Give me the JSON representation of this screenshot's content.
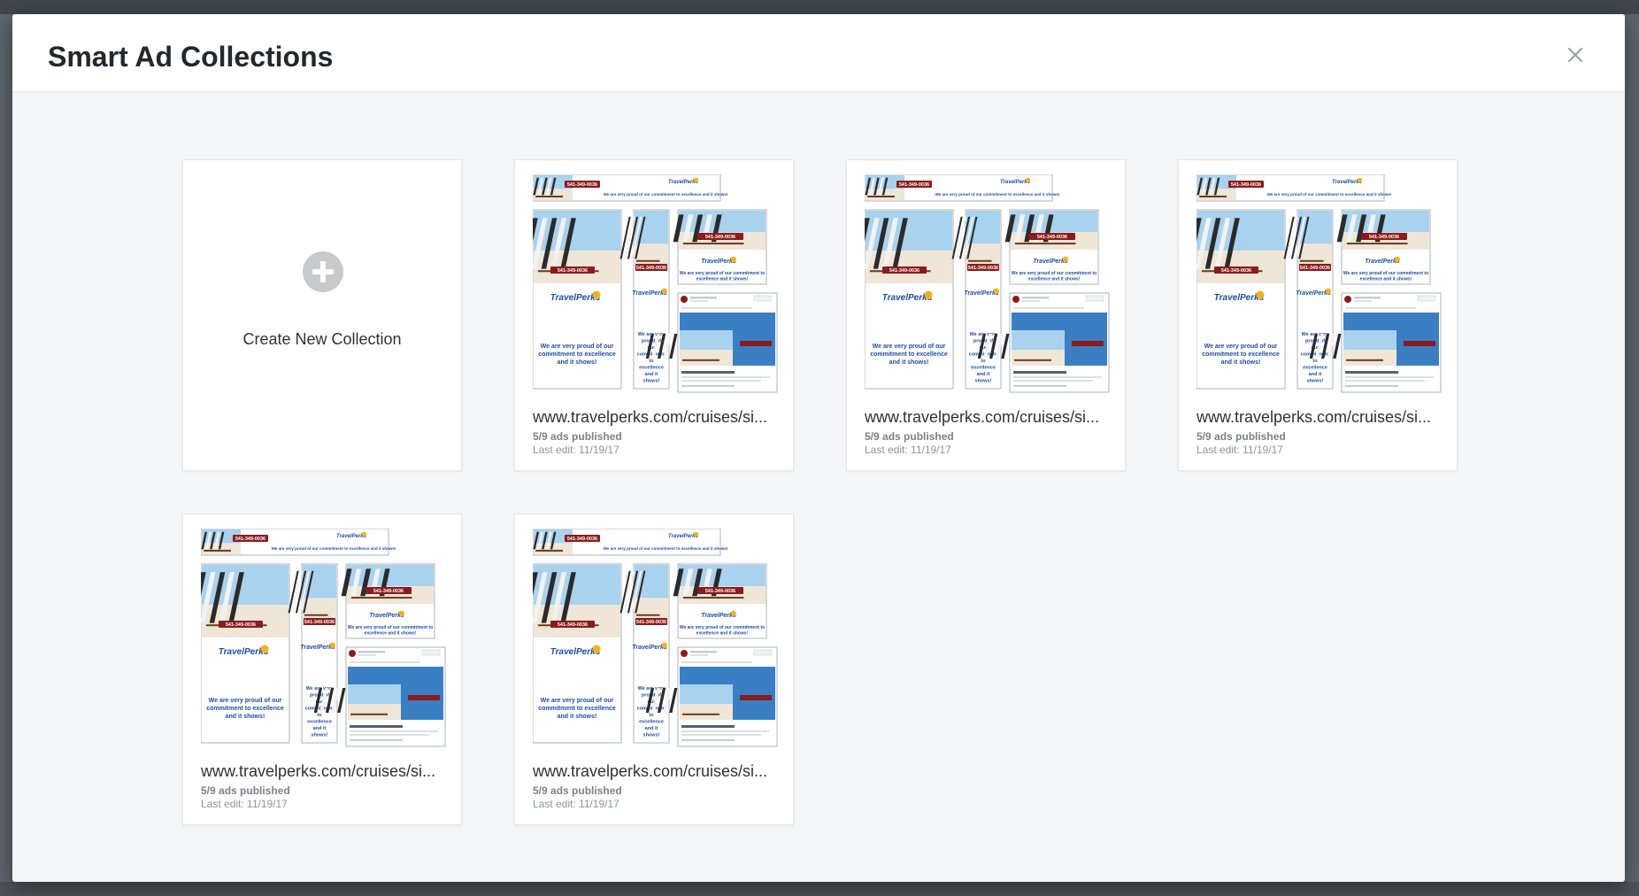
{
  "modal": {
    "title": "Smart Ad Collections",
    "close_label": "×"
  },
  "create_card": {
    "label": "Create New Collection"
  },
  "collections": [
    {
      "url": "www.travelperks.com/cruises/si...",
      "published": "5/9 ads published",
      "last_edit": "Last edit: 11/19/17"
    },
    {
      "url": "www.travelperks.com/cruises/si...",
      "published": "5/9 ads published",
      "last_edit": "Last edit: 11/19/17"
    },
    {
      "url": "www.travelperks.com/cruises/si...",
      "published": "5/9 ads published",
      "last_edit": "Last edit: 11/19/17"
    },
    {
      "url": "www.travelperks.com/cruises/si...",
      "published": "5/9 ads published",
      "last_edit": "Last edit: 11/19/17"
    },
    {
      "url": "www.travelperks.com/cruises/si...",
      "published": "5/9 ads published",
      "last_edit": "Last edit: 11/19/17"
    }
  ],
  "ad_preview": {
    "phone": "541-349-0036",
    "brand": "TravelPerks",
    "tagline": "We are very proud of our commitment to excellence and it shows!",
    "short_tagline": "We are very proud of our commitment to excellence and it shows!"
  },
  "colors": {
    "brand_red": "#8b1c1c",
    "brand_blue": "#1f4ea3",
    "sky": "#a9d2ee",
    "sand": "#efe6d8"
  }
}
